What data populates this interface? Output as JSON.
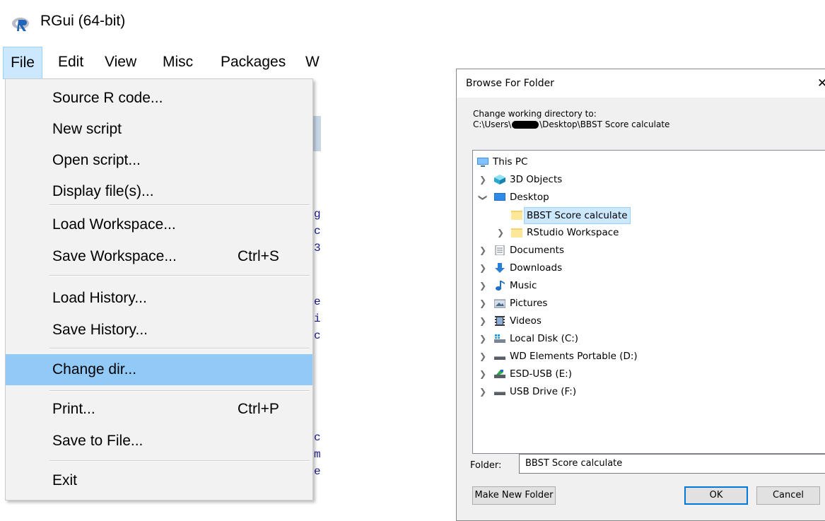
{
  "window": {
    "title": "RGui (64-bit)",
    "icon": "r-logo-icon"
  },
  "menubar": {
    "items": [
      {
        "label": "File",
        "active": true
      },
      {
        "label": "Edit"
      },
      {
        "label": "View"
      },
      {
        "label": "Misc"
      },
      {
        "label": "Packages"
      },
      {
        "label": "W"
      }
    ]
  },
  "file_menu": {
    "items": [
      {
        "label": "Source R code...",
        "shortcut": ""
      },
      {
        "label": "New script",
        "shortcut": ""
      },
      {
        "label": "Open script...",
        "shortcut": ""
      },
      {
        "label": "Display file(s)...",
        "shortcut": ""
      },
      {
        "label": "Load Workspace...",
        "shortcut": ""
      },
      {
        "label": "Save Workspace...",
        "shortcut": "Ctrl+S"
      },
      {
        "label": "Load History...",
        "shortcut": ""
      },
      {
        "label": "Save History...",
        "shortcut": ""
      },
      {
        "label": "Change dir...",
        "shortcut": "",
        "highlighted": true
      },
      {
        "label": "Print...",
        "shortcut": "Ctrl+P"
      },
      {
        "label": "Save to File...",
        "shortcut": ""
      },
      {
        "label": "Exit",
        "shortcut": ""
      }
    ]
  },
  "console_fragments": [
    "g",
    "c",
    "3",
    "e",
    "i",
    "c",
    "c",
    "m",
    "e"
  ],
  "dialog": {
    "title": "Browse For Folder",
    "close_icon": "close-icon",
    "description_line1": "Change working directory to:",
    "path_prefix": "C:\\Users\\",
    "path_suffix": "\\Desktop\\BBST Score calculate",
    "tree": [
      {
        "label": "This PC",
        "icon": "pc-icon",
        "chevron": ""
      },
      {
        "label": "3D Objects",
        "icon": "cube-icon",
        "chevron": ">"
      },
      {
        "label": "Desktop",
        "icon": "desktop-icon",
        "chevron": "v"
      },
      {
        "label": "BBST Score calculate",
        "icon": "folder-icon",
        "chevron": "",
        "selected": true
      },
      {
        "label": "RStudio Workspace",
        "icon": "folder-icon",
        "chevron": ">"
      },
      {
        "label": "Documents",
        "icon": "document-icon",
        "chevron": ">"
      },
      {
        "label": "Downloads",
        "icon": "download-icon",
        "chevron": ">"
      },
      {
        "label": "Music",
        "icon": "music-icon",
        "chevron": ">"
      },
      {
        "label": "Pictures",
        "icon": "pictures-icon",
        "chevron": ">"
      },
      {
        "label": "Videos",
        "icon": "video-icon",
        "chevron": ">"
      },
      {
        "label": "Local Disk (C:)",
        "icon": "windows-drive-icon",
        "chevron": ">"
      },
      {
        "label": "WD Elements Portable (D:)",
        "icon": "drive-icon",
        "chevron": ">"
      },
      {
        "label": "ESD-USB (E:)",
        "icon": "usb-drive-icon",
        "chevron": ">"
      },
      {
        "label": "USB Drive (F:)",
        "icon": "drive-icon",
        "chevron": ">"
      }
    ],
    "folder_label": "Folder:",
    "folder_value": "BBST Score calculate",
    "buttons": {
      "make_new_folder": "Make New Folder",
      "ok": "OK",
      "cancel": "Cancel"
    }
  },
  "colors": {
    "menu_highlight": "#91c9f7",
    "selection": "#cce8ff",
    "accent": "#0078d7"
  }
}
